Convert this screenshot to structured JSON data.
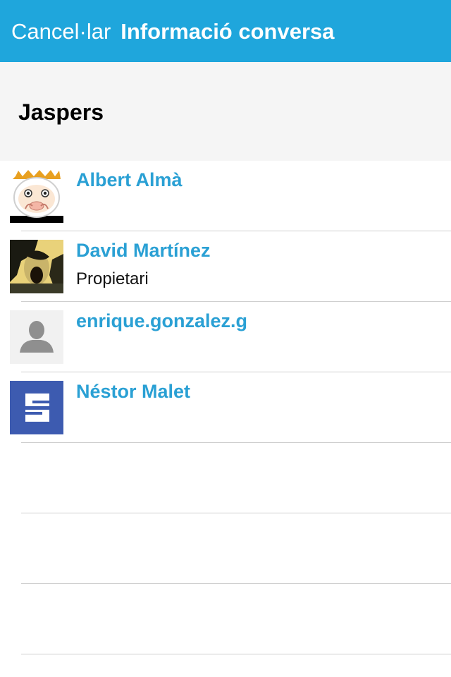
{
  "navbar": {
    "cancel_label": "Cancel·lar",
    "title": "Informació conversa",
    "background_color": "#1fa6dc"
  },
  "group": {
    "name": "Jaspers"
  },
  "members": [
    {
      "name": "Albert Almà",
      "role": "",
      "avatar": "cartoon-character-avatar"
    },
    {
      "name": "David Martínez",
      "role": "Propietari",
      "avatar": "photo-avatar"
    },
    {
      "name": "enrique.gonzalez.g",
      "role": "",
      "avatar": "default-person-avatar"
    },
    {
      "name": "Néstor Malet",
      "role": "",
      "avatar": "s-logo-avatar"
    }
  ],
  "colors": {
    "accent": "#1fa6dc",
    "member_name": "#2aa0d4",
    "header_bg": "#f5f5f5"
  }
}
